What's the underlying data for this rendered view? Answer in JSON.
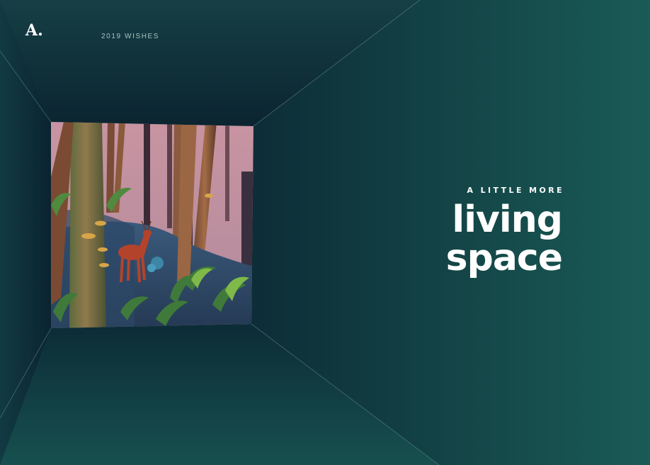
{
  "header": {
    "logo_text": "A.",
    "nav_label": "2019 WISHES"
  },
  "headline": {
    "kicker": "A LITTLE MORE",
    "title_line_1": "living",
    "title_line_2": "space"
  },
  "colors": {
    "background_teal": "#1b5c57",
    "room_dark": "#0c2a34",
    "text_primary": "#ffffff",
    "text_muted": "#a9c3c1",
    "scene_sky": "#c99aa6",
    "deer": "#b4432b"
  },
  "scene": {
    "illustration": "forest-with-deer"
  }
}
